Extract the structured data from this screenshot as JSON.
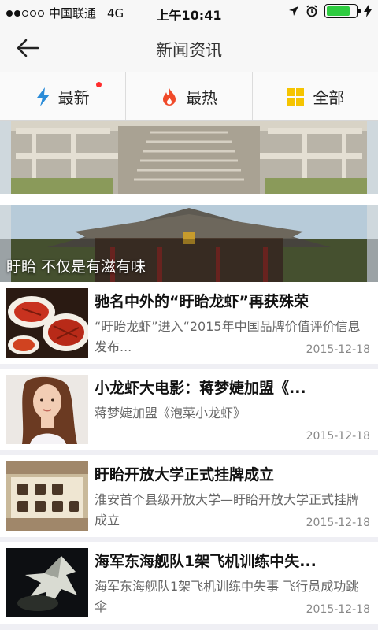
{
  "status_bar": {
    "carrier": "中国联通",
    "network": "4G",
    "time": "上午10:41",
    "battery_level": 0.8,
    "icons": [
      "signal-dots-icon",
      "location-arrow-icon",
      "alarm-clock-icon",
      "battery-icon",
      "charging-bolt-icon"
    ]
  },
  "nav": {
    "title": "新闻资讯",
    "back_icon": "back-arrow-icon"
  },
  "tabs": [
    {
      "label": "最新",
      "icon": "lightning-icon",
      "icon_color": "#2b8cd8",
      "badge": true
    },
    {
      "label": "最热",
      "icon": "fire-icon",
      "icon_color": "#f04a2a",
      "badge": false
    },
    {
      "label": "全部",
      "icon": "grid-icon",
      "icon_color": "#f5c400",
      "badge": false
    }
  ],
  "banner": {
    "caption": "盱眙 不仅是有滋有味"
  },
  "news": [
    {
      "title": "驰名中外的“盱眙龙虾”再获殊荣",
      "summary": "“盱眙龙虾”进入“2015年中国品牌价值评价信息发布...",
      "date": "2015-12-18",
      "thumb": "crayfish-dish-image"
    },
    {
      "title": "小龙虾大电影：蒋梦婕加盟《...",
      "summary": "蒋梦婕加盟《泡菜小龙虾》",
      "date": "2015-12-18",
      "thumb": "actress-portrait-image"
    },
    {
      "title": "盱眙开放大学正式挂牌成立",
      "summary": "淮安首个县级开放大学—盱眙开放大学正式挂牌成立",
      "date": "2015-12-18",
      "thumb": "calligraphy-plaque-image"
    },
    {
      "title": "海军东海舰队1架飞机训练中失...",
      "summary": "海军东海舰队1架飞机训练中失事 飞行员成功跳伞",
      "date": "2015-12-18",
      "thumb": "night-aircraft-image"
    }
  ],
  "colors": {
    "accent_red": "#ff2d2d",
    "battery_green": "#2ecc40"
  }
}
